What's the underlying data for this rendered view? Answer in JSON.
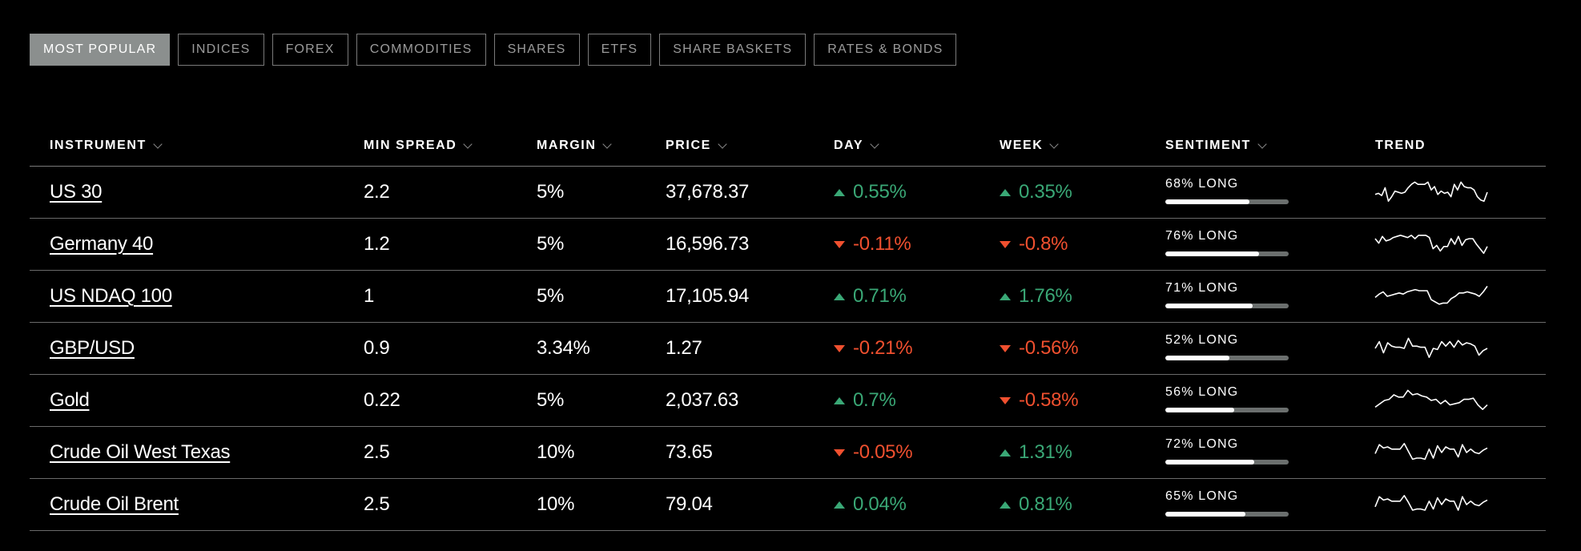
{
  "tabs": [
    {
      "label": "MOST POPULAR",
      "active": true
    },
    {
      "label": "INDICES",
      "active": false
    },
    {
      "label": "FOREX",
      "active": false
    },
    {
      "label": "COMMODITIES",
      "active": false
    },
    {
      "label": "SHARES",
      "active": false
    },
    {
      "label": "ETFS",
      "active": false
    },
    {
      "label": "SHARE BASKETS",
      "active": false
    },
    {
      "label": "RATES & BONDS",
      "active": false
    }
  ],
  "table": {
    "columns": {
      "instrument": "INSTRUMENT",
      "min_spread": "MIN SPREAD",
      "margin": "MARGIN",
      "price": "PRICE",
      "day": "DAY",
      "week": "WEEK",
      "sentiment": "SENTIMENT",
      "trend": "TREND"
    },
    "rows": [
      {
        "instrument": "US 30",
        "min_spread": "2.2",
        "margin": "5%",
        "price": "37,678.37",
        "day": {
          "value": "0.55%",
          "direction": "up"
        },
        "week": {
          "value": "0.35%",
          "direction": "up"
        },
        "sentiment": {
          "label": "68% LONG",
          "long_pct": 68
        },
        "trend": [
          0.4,
          0.45,
          0.35,
          0.7,
          0.1,
          0.3,
          0.55,
          0.5,
          0.45,
          0.5,
          0.7,
          0.85,
          0.95,
          0.85,
          0.85,
          0.85,
          0.95,
          0.6,
          0.75,
          0.4,
          0.55,
          0.45,
          0.5,
          0.3,
          0.85,
          0.6,
          0.95,
          0.75,
          0.7,
          0.7,
          0.6,
          0.3,
          0.15,
          0.1,
          0.5
        ]
      },
      {
        "instrument": "Germany 40",
        "min_spread": "1.2",
        "margin": "5%",
        "price": "16,596.73",
        "day": {
          "value": "-0.11%",
          "direction": "down"
        },
        "week": {
          "value": "-0.8%",
          "direction": "down"
        },
        "sentiment": {
          "label": "76% LONG",
          "long_pct": 76
        },
        "trend": [
          0.75,
          0.55,
          0.85,
          0.65,
          0.7,
          0.8,
          0.85,
          0.9,
          0.85,
          0.8,
          0.9,
          0.75,
          0.9,
          0.9,
          0.9,
          0.8,
          0.3,
          0.45,
          0.2,
          0.4,
          0.4,
          0.75,
          0.5,
          0.85,
          0.45,
          0.7,
          0.75,
          0.75,
          0.5,
          0.3,
          0.1,
          0.4
        ]
      },
      {
        "instrument": "US NDAQ 100",
        "min_spread": "1",
        "margin": "5%",
        "price": "17,105.94",
        "day": {
          "value": "0.71%",
          "direction": "up"
        },
        "week": {
          "value": "1.76%",
          "direction": "up"
        },
        "sentiment": {
          "label": "71% LONG",
          "long_pct": 71
        },
        "trend": [
          0.45,
          0.6,
          0.7,
          0.5,
          0.55,
          0.6,
          0.65,
          0.6,
          0.7,
          0.75,
          0.8,
          0.75,
          0.75,
          0.75,
          0.35,
          0.25,
          0.15,
          0.2,
          0.2,
          0.4,
          0.5,
          0.65,
          0.65,
          0.7,
          0.65,
          0.6,
          0.5,
          0.7,
          0.95
        ]
      },
      {
        "instrument": "GBP/USD",
        "min_spread": "0.9",
        "margin": "3.34%",
        "price": "1.27",
        "day": {
          "value": "-0.21%",
          "direction": "down"
        },
        "week": {
          "value": "-0.56%",
          "direction": "down"
        },
        "sentiment": {
          "label": "52% LONG",
          "long_pct": 52
        },
        "trend": [
          0.5,
          0.8,
          0.3,
          0.75,
          0.6,
          0.55,
          0.55,
          0.5,
          0.95,
          0.6,
          0.6,
          0.55,
          0.55,
          0.1,
          0.5,
          0.45,
          0.8,
          0.6,
          0.8,
          0.55,
          0.85,
          0.65,
          0.75,
          0.7,
          0.6,
          0.2,
          0.4,
          0.5
        ]
      },
      {
        "instrument": "Gold",
        "min_spread": "0.22",
        "margin": "5%",
        "price": "2,037.63",
        "day": {
          "value": "0.7%",
          "direction": "up"
        },
        "week": {
          "value": "-0.58%",
          "direction": "down"
        },
        "sentiment": {
          "label": "56% LONG",
          "long_pct": 56
        },
        "trend": [
          0.2,
          0.35,
          0.5,
          0.55,
          0.75,
          0.65,
          0.65,
          0.95,
          0.75,
          0.8,
          0.7,
          0.65,
          0.5,
          0.55,
          0.35,
          0.5,
          0.3,
          0.35,
          0.4,
          0.55,
          0.55,
          0.6,
          0.3,
          0.1,
          0.3
        ]
      },
      {
        "instrument": "Crude Oil West Texas",
        "min_spread": "2.5",
        "margin": "10%",
        "price": "73.65",
        "day": {
          "value": "-0.05%",
          "direction": "down"
        },
        "week": {
          "value": "1.31%",
          "direction": "up"
        },
        "sentiment": {
          "label": "72% LONG",
          "long_pct": 72
        },
        "trend": [
          0.45,
          0.85,
          0.7,
          0.75,
          0.65,
          0.65,
          0.65,
          0.9,
          0.55,
          0.2,
          0.25,
          0.25,
          0.2,
          0.65,
          0.25,
          0.8,
          0.5,
          0.75,
          0.65,
          0.65,
          0.3,
          0.85,
          0.5,
          0.65,
          0.5,
          0.45,
          0.6,
          0.7
        ]
      },
      {
        "instrument": "Crude Oil Brent",
        "min_spread": "2.5",
        "margin": "10%",
        "price": "79.04",
        "day": {
          "value": "0.04%",
          "direction": "up"
        },
        "week": {
          "value": "0.81%",
          "direction": "up"
        },
        "sentiment": {
          "label": "65% LONG",
          "long_pct": 65
        },
        "trend": [
          0.4,
          0.85,
          0.7,
          0.75,
          0.65,
          0.65,
          0.65,
          0.9,
          0.6,
          0.25,
          0.3,
          0.3,
          0.25,
          0.65,
          0.3,
          0.8,
          0.5,
          0.75,
          0.65,
          0.65,
          0.25,
          0.85,
          0.5,
          0.65,
          0.5,
          0.45,
          0.6,
          0.7
        ]
      }
    ]
  }
}
